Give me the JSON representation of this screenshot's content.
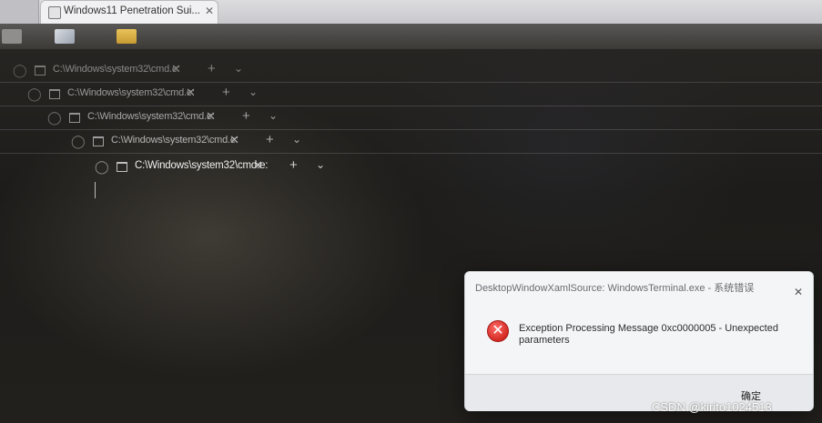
{
  "outer_tab": {
    "title": "Windows11 Penetration Sui...",
    "close_glyph": "✕"
  },
  "terminal_tabs": [
    {
      "label": "C:\\Windows\\system32\\cmd.e:",
      "close": "✕",
      "plus": "+",
      "down": "⌄"
    },
    {
      "label": "C:\\Windows\\system32\\cmd.e:",
      "close": "✕",
      "plus": "+",
      "down": "⌄"
    },
    {
      "label": "C:\\Windows\\system32\\cmd.e:",
      "close": "✕",
      "plus": "+",
      "down": "⌄"
    },
    {
      "label": "C:\\Windows\\system32\\cmd.e:",
      "close": "✕",
      "plus": "+",
      "down": "⌄"
    },
    {
      "label": "C:\\Windows\\system32\\cmd.e:",
      "close": "✕",
      "plus": "+",
      "down": "⌄"
    }
  ],
  "dialog": {
    "title": "DesktopWindowXamlSource: WindowsTerminal.exe - 系统错误",
    "close_glyph": "✕",
    "error_glyph": "✕",
    "message": "Exception Processing Message 0xc0000005 - Unexpected parameters",
    "ok_label": "确定"
  },
  "watermark": "CSDN @kirito1024513",
  "icons": [
    "shield-icon",
    "terminal-icon",
    "close-icon",
    "plus-icon",
    "chevron-down-icon",
    "error-icon"
  ]
}
